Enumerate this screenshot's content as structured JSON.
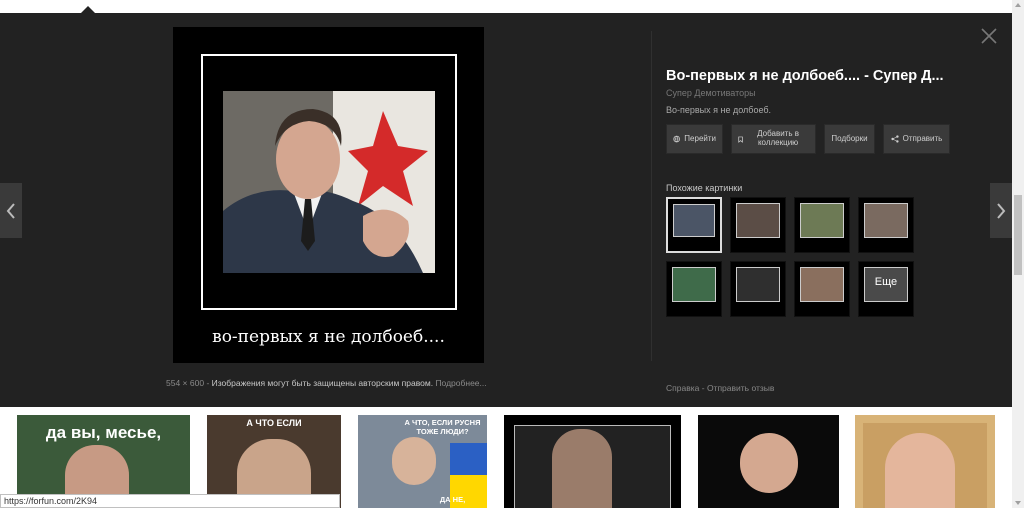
{
  "viewer": {
    "main_image": {
      "caption": "во-первых я не долбоеб....",
      "dimensions": "554 × 600",
      "copyright_notice": "Изображения могут быть защищены авторским правом.",
      "more_link": "Подробнее..."
    },
    "info": {
      "title": "Во-первых я не долбоеб.... - Супер Д...",
      "source": "Супер Демотиваторы",
      "description": "Во-первых я не долбоеб."
    },
    "actions": {
      "visit": "Перейти",
      "add_to_collection": "Добавить в коллекцию",
      "collections": "Подборки",
      "share": "Отправить"
    },
    "similar": {
      "label": "Похожие картинки",
      "more_label": "Еще"
    },
    "footer": {
      "help": "Справка",
      "separator": "-",
      "feedback": "Отправить отзыв"
    }
  },
  "strip": {
    "thumb1_text": "да вы, месье,",
    "thumb2_text": "А ЧТО ЕСЛИ",
    "thumb3_text": "А ЧТО, ЕСЛИ РУСНЯ ТОЖЕ ЛЮДИ?",
    "thumb3_bottom": "ДА НЕ,"
  },
  "status_bar": {
    "url": "https://forfun.com/2K94"
  },
  "colors": {
    "viewer_bg": "#222222",
    "button_bg": "#3a3a3a",
    "title": "#ffffff"
  }
}
